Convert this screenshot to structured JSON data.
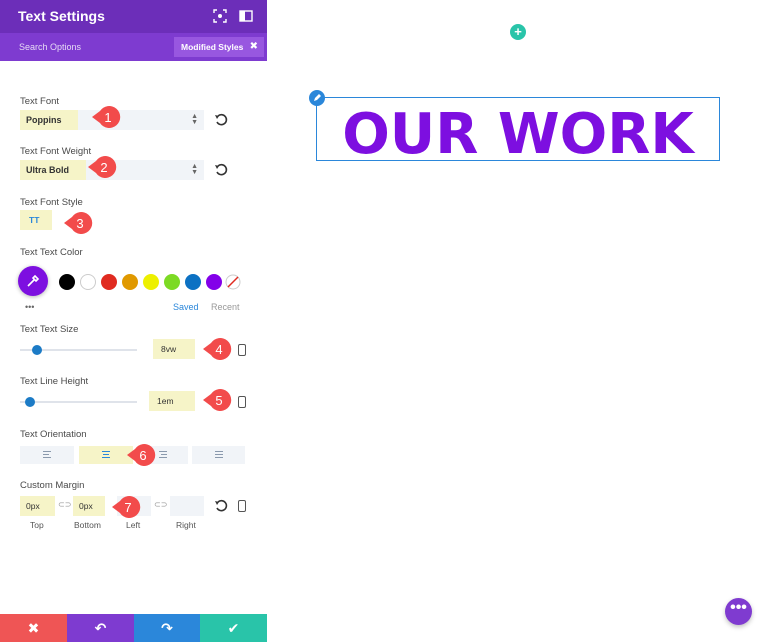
{
  "panel": {
    "title": "Text Settings",
    "search_placeholder": "Search Options",
    "modified_styles_label": "Modified Styles",
    "modified_styles_close": "✖"
  },
  "fields": {
    "font": {
      "label": "Text Font",
      "value": "Poppins",
      "badge": "1"
    },
    "weight": {
      "label": "Text Font Weight",
      "value": "Ultra Bold",
      "badge": "2"
    },
    "style": {
      "label": "Text Font Style",
      "value": "TT",
      "badge": "3"
    },
    "color": {
      "label": "Text Text Color",
      "swatches": [
        "#000000",
        "#ffffff",
        "#e02b20",
        "#e09900",
        "#edf000",
        "#7cda24",
        "#0c71c3",
        "#8300e9"
      ],
      "picker_color": "#7d0fe0",
      "saved_tab": "Saved",
      "recent_tab": "Recent",
      "more": "•••"
    },
    "size": {
      "label": "Text Text Size",
      "value": "8vw",
      "badge": "4",
      "slider_fraction": 0.1
    },
    "line_height": {
      "label": "Text Line Height",
      "value": "1em",
      "badge": "5",
      "slider_fraction": 0.04
    },
    "orientation": {
      "label": "Text Orientation",
      "selected": "center",
      "badge": "6"
    },
    "margin": {
      "label": "Custom Margin",
      "top_value": "0px",
      "bottom_value": "0px",
      "left_value": "",
      "right_value": "",
      "top_label": "Top",
      "bottom_label": "Bottom",
      "left_label": "Left",
      "right_label": "Right",
      "badge": "7"
    }
  },
  "bottom_bar": {
    "cancel": "✖",
    "undo": "↶",
    "redo": "↷",
    "save": "✔",
    "colors": {
      "cancel": "#ef5555",
      "undo": "#7e3bd0",
      "redo": "#2b87da",
      "save": "#29c4a9"
    }
  },
  "canvas": {
    "heading": "OUR WORK",
    "heading_color": "#7d0fe0",
    "add_button": "+",
    "more_button": "•••"
  },
  "colors": {
    "accent_purple": "#6c2eb9",
    "badge_red": "#f24b4b",
    "highlight": "#f6f4c8"
  }
}
